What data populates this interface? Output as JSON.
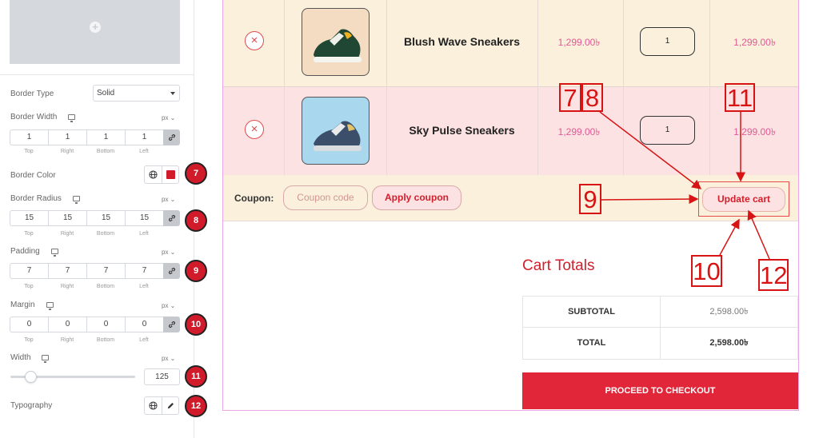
{
  "panel": {
    "border_type": {
      "label": "Border Type",
      "value": "Solid"
    },
    "border_width": {
      "label": "Border Width",
      "unit": "px",
      "values": [
        "1",
        "1",
        "1",
        "1"
      ]
    },
    "border_color": {
      "label": "Border Color",
      "swatch": "#d11a2a"
    },
    "border_radius": {
      "label": "Border Radius",
      "unit": "px",
      "values": [
        "15",
        "15",
        "15",
        "15"
      ]
    },
    "padding": {
      "label": "Padding",
      "unit": "px",
      "values": [
        "7",
        "7",
        "7",
        "7"
      ]
    },
    "margin": {
      "label": "Margin",
      "unit": "px",
      "values": [
        "0",
        "0",
        "0",
        "0"
      ]
    },
    "width": {
      "label": "Width",
      "unit": "px",
      "value": "125"
    },
    "typography": {
      "label": "Typography"
    },
    "dim_labels": [
      "Top",
      "Right",
      "Bottom",
      "Left"
    ],
    "badges": [
      "7",
      "8",
      "9",
      "10",
      "11",
      "12"
    ]
  },
  "cart": {
    "items": [
      {
        "name": "Blush Wave Sneakers",
        "price": "1,299.00৳",
        "qty": "1",
        "subtotal": "1,299.00৳",
        "remove": "×",
        "thumb_bg": "#f3dcc2"
      },
      {
        "name": "Sky Pulse Sneakers",
        "price": "1,299.00৳",
        "qty": "1",
        "subtotal": "1,299.00৳",
        "remove": "×",
        "thumb_bg": "#a9d8ee"
      }
    ],
    "coupon_label": "Coupon:",
    "coupon_placeholder": "Coupon code",
    "apply_label": "Apply coupon",
    "update_label": "Update cart"
  },
  "totals": {
    "title": "Cart Totals",
    "subtotal_label": "SUBTOTAL",
    "subtotal_value": "2,598.00৳",
    "total_label": "TOTAL",
    "total_value": "2,598.00৳",
    "checkout_label": "PROCEED TO CHECKOUT"
  },
  "annotations": [
    "7",
    "8",
    "9",
    "10",
    "11",
    "12"
  ],
  "colors": {
    "accent": "#d1202c",
    "row_cream": "#faf0dc",
    "row_pink": "#fde2e3",
    "annotation": "#d81313"
  }
}
